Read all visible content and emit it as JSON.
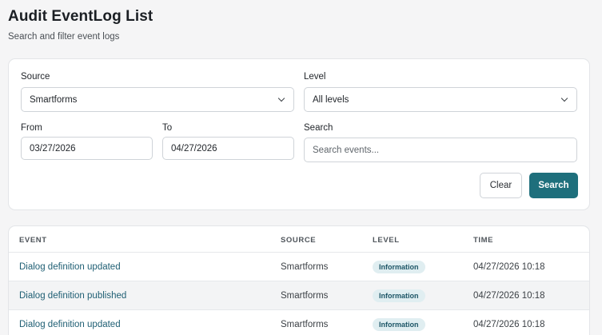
{
  "header": {
    "title": "Audit EventLog List",
    "subtitle": "Search and filter event logs"
  },
  "filters": {
    "source": {
      "label": "Source",
      "value": "Smartforms"
    },
    "level": {
      "label": "Level",
      "value": "All levels"
    },
    "from": {
      "label": "From",
      "value": "03/27/2026"
    },
    "to": {
      "label": "To",
      "value": "04/27/2026"
    },
    "search": {
      "label": "Search",
      "value": "",
      "placeholder": "Search events..."
    },
    "clear_label": "Clear",
    "search_label": "Search"
  },
  "table": {
    "columns": [
      "EVENT",
      "SOURCE",
      "LEVEL",
      "TIME"
    ],
    "rows": [
      {
        "event": "Dialog definition updated",
        "source": "Smartforms",
        "level": "Information",
        "time": "04/27/2026 10:18"
      },
      {
        "event": "Dialog definition published",
        "source": "Smartforms",
        "level": "Information",
        "time": "04/27/2026 10:18"
      },
      {
        "event": "Dialog definition updated",
        "source": "Smartforms",
        "level": "Information",
        "time": "04/27/2026 10:18"
      }
    ]
  },
  "colors": {
    "accent": "#1e6f7c",
    "link": "#1e5e73",
    "badge_bg": "#e0eef1"
  }
}
